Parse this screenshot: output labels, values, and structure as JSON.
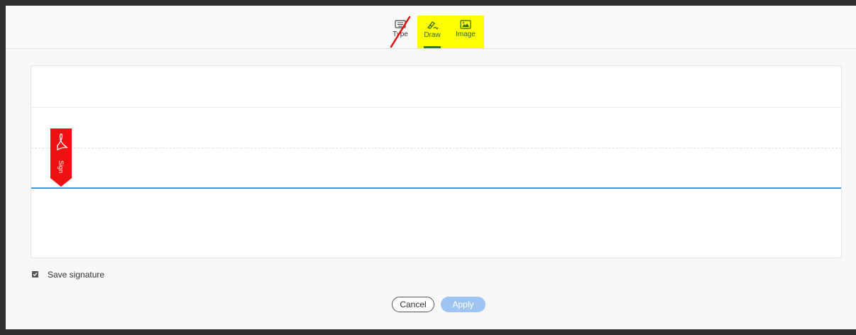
{
  "tabs": [
    {
      "label": "Type",
      "icon": "keyboard-icon",
      "crossed_out": true
    },
    {
      "label": "Draw",
      "icon": "pen-icon",
      "selected": true,
      "highlight": "#ffff00"
    },
    {
      "label": "Image",
      "icon": "image-icon",
      "highlight": "#ffff00"
    }
  ],
  "sign_flag": {
    "label": "Sign",
    "color": "#ee1111"
  },
  "save_signature": {
    "label": "Save signature",
    "checked": true
  },
  "buttons": {
    "cancel": "Cancel",
    "apply": "Apply"
  },
  "colors": {
    "accent": "#4a90d9",
    "apply_disabled": "#9ec5f1",
    "highlight": "#ffff00"
  }
}
